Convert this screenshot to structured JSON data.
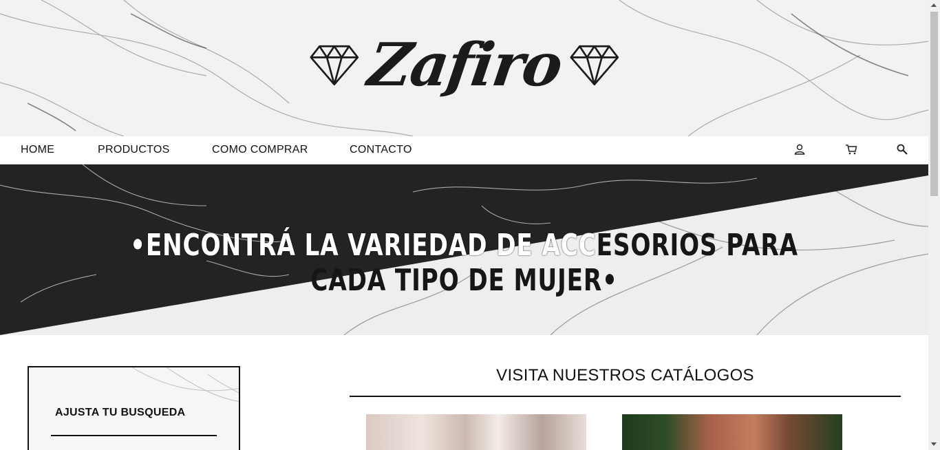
{
  "brand": {
    "logo_text": "Zafiro"
  },
  "nav": {
    "items": [
      {
        "label": "HOME"
      },
      {
        "label": "PRODUCTOS"
      },
      {
        "label": "COMO COMPRAR"
      },
      {
        "label": "CONTACTO"
      }
    ],
    "icons": [
      "user-icon",
      "cart-icon",
      "search-icon"
    ]
  },
  "banner": {
    "text_white": "•ENCONTRÁ LA VARIEDAD DE ACC",
    "text_dark": "ESORIOS PARA CADA TIPO DE MUJER•"
  },
  "filter": {
    "title": "AJUSTA TU BUSQUEDA"
  },
  "catalogs": {
    "title": "VISITA NUESTROS CATÁLOGOS"
  },
  "colors": {
    "dark": "#1a1a1a",
    "marble_light": "#efefef"
  }
}
